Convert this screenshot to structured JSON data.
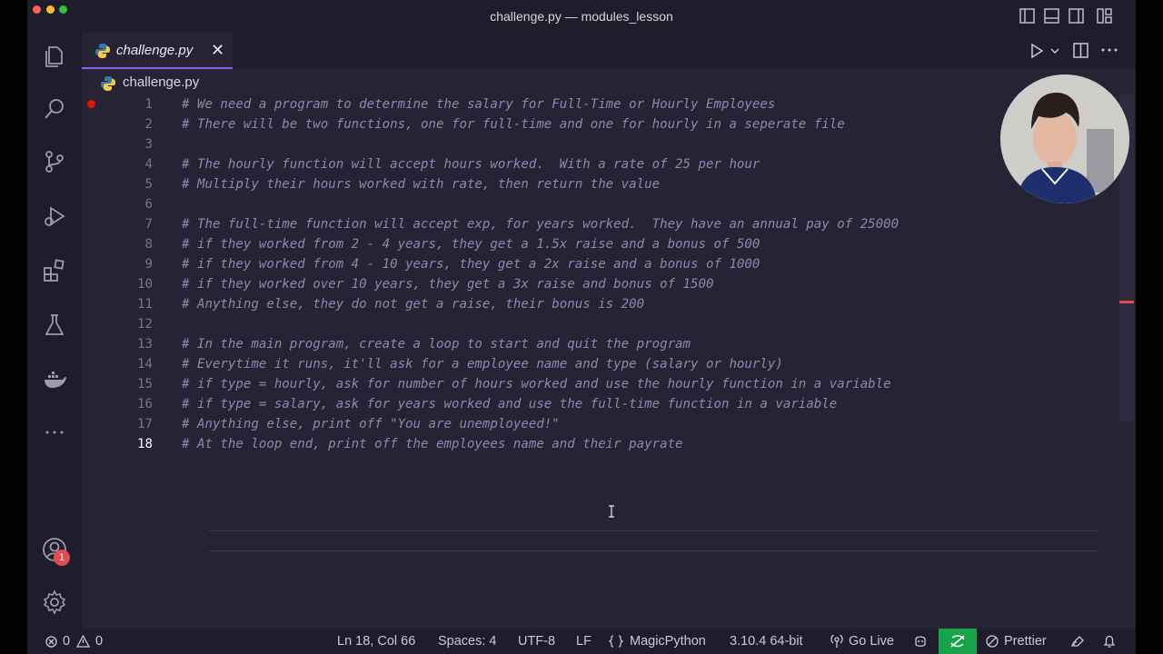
{
  "window": {
    "title": "challenge.py — modules_lesson",
    "traffic_colors": [
      "#ff5f57",
      "#febc2e",
      "#28c840"
    ]
  },
  "tab": {
    "label": "challenge.py",
    "close_glyph": "✕"
  },
  "breadcrumb": {
    "file": "challenge.py"
  },
  "editor": {
    "current_line": 18,
    "lines": [
      {
        "n": "1",
        "text": "# We need a program to determine the salary for Full-Time or Hourly Employees"
      },
      {
        "n": "2",
        "text": "# There will be two functions, one for full-time and one for hourly in a seperate file"
      },
      {
        "n": "3",
        "text": ""
      },
      {
        "n": "4",
        "text": "# The hourly function will accept hours worked.  With a rate of 25 per hour"
      },
      {
        "n": "5",
        "text": "# Multiply their hours worked with rate, then return the value"
      },
      {
        "n": "6",
        "text": ""
      },
      {
        "n": "7",
        "text": "# The full-time function will accept exp, for years worked.  They have an annual pay of 25000"
      },
      {
        "n": "8",
        "text": "# if they worked from 2 - 4 years, they get a 1.5x raise and a bonus of 500"
      },
      {
        "n": "9",
        "text": "# if they worked from 4 - 10 years, they get a 2x raise and a bonus of 1000"
      },
      {
        "n": "10",
        "text": "# if they worked over 10 years, they get a 3x raise and bonus of 1500"
      },
      {
        "n": "11",
        "text": "# Anything else, they do not get a raise, their bonus is 200"
      },
      {
        "n": "12",
        "text": ""
      },
      {
        "n": "13",
        "text": "# In the main program, create a loop to start and quit the program"
      },
      {
        "n": "14",
        "text": "# Everytime it runs, it'll ask for a employee name and type (salary or hourly)"
      },
      {
        "n": "15",
        "text": "# if type = hourly, ask for number of hours worked and use the hourly function in a variable"
      },
      {
        "n": "16",
        "text": "# if type = salary, ask for years worked and use the full-time function in a variable"
      },
      {
        "n": "17",
        "text": "# Anything else, print off \"You are unemployeed!\""
      },
      {
        "n": "18",
        "text": "# At the loop end, print off the employees name and their payrate"
      }
    ]
  },
  "activity_bar": {
    "icons": [
      "explorer-icon",
      "search-icon",
      "source-control-icon",
      "run-debug-icon",
      "extensions-icon",
      "testing-icon",
      "docker-icon",
      "more-icon"
    ],
    "account_badge": "1"
  },
  "status": {
    "errors": "0",
    "warnings": "0",
    "position": "Ln 18, Col 66",
    "spaces": "Spaces: 4",
    "encoding": "UTF-8",
    "eol": "LF",
    "language": "MagicPython",
    "interpreter": "3.10.4 64-bit",
    "go_live": "Go Live",
    "prettier": "Prettier"
  },
  "colors": {
    "editor_bg": "#262335",
    "comment": "#8e88b0",
    "accent": "#8b5cf6",
    "live_share": "#16a34a",
    "breakpoint": "#e51400"
  }
}
